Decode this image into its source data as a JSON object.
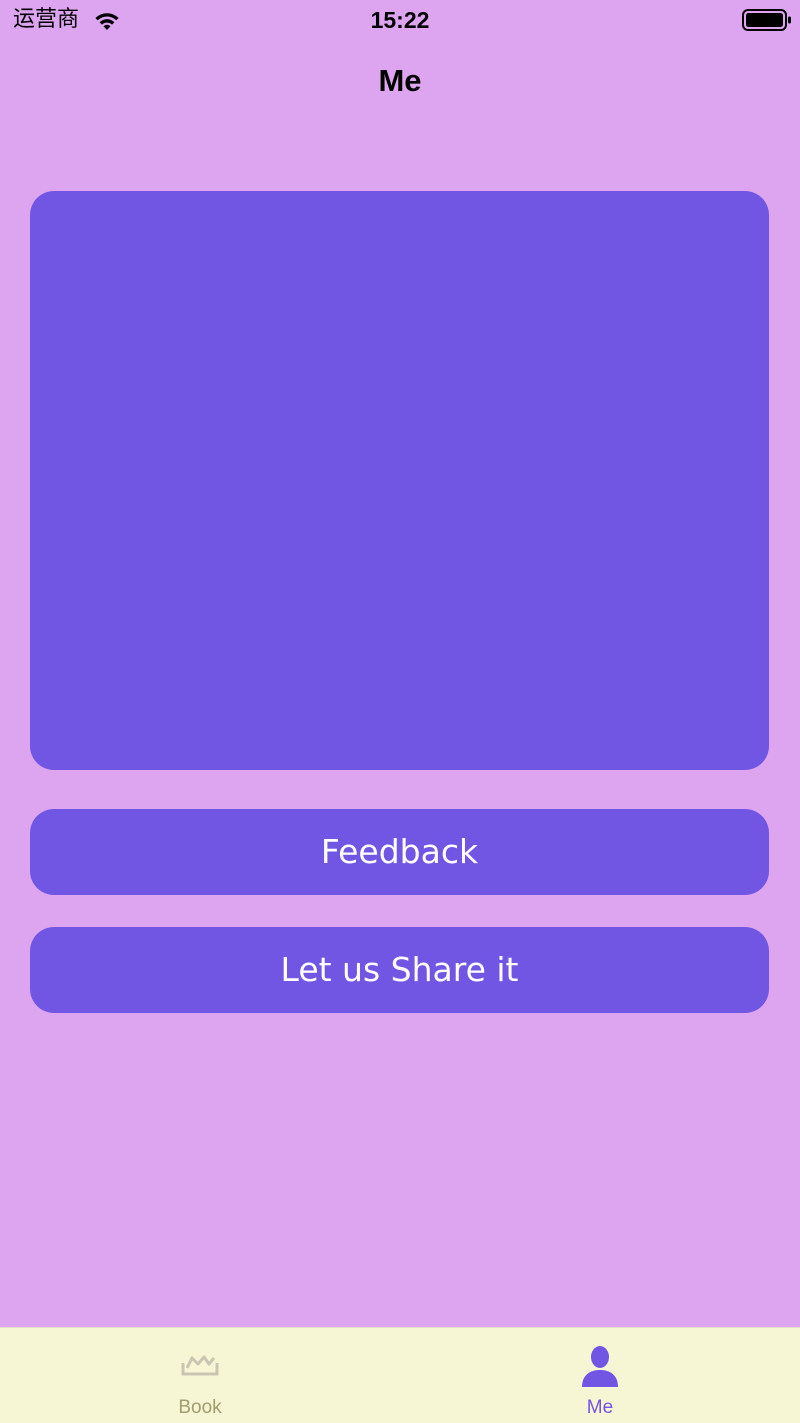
{
  "status_bar": {
    "carrier": "运营商",
    "time": "15:22",
    "wifi_icon": "wifi-icon",
    "battery_icon": "battery-icon"
  },
  "nav": {
    "title": "Me"
  },
  "buttons": {
    "feedback_label": "Feedback",
    "share_label": "Let us Share it"
  },
  "tab_bar": {
    "tabs": [
      {
        "label": "Book",
        "icon": "book-icon",
        "selected": false
      },
      {
        "label": "Me",
        "icon": "person-icon",
        "selected": true
      }
    ]
  },
  "colors": {
    "background": "#DDA4EF",
    "accent": "#7156E4",
    "tab_bar_background": "#F6F6D4",
    "tab_inactive": "#A29C6E"
  }
}
